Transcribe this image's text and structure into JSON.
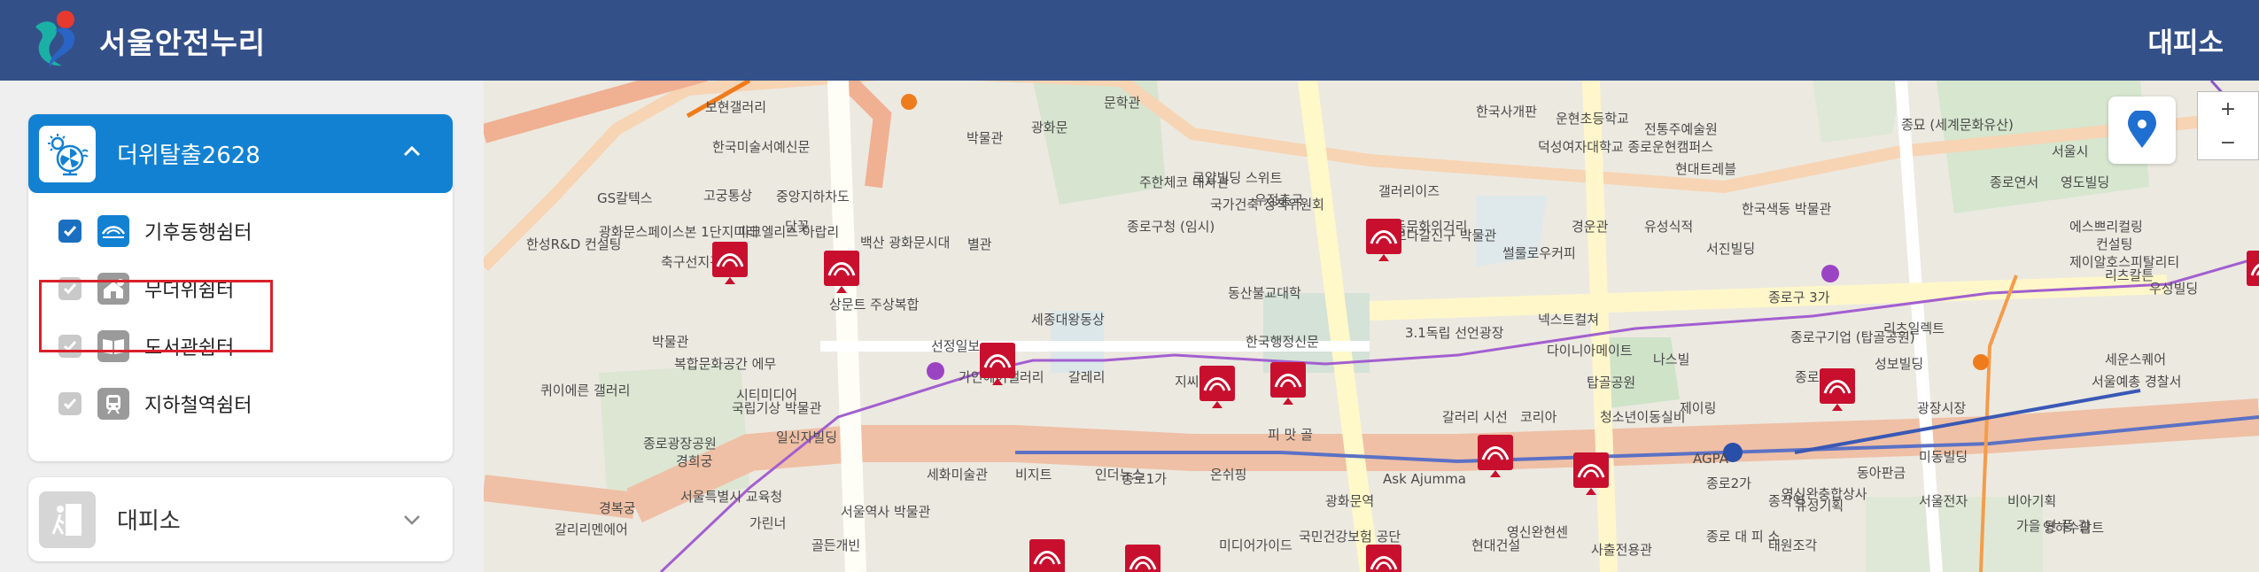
{
  "header": {
    "app_title": "서울안전누리",
    "right_label": "대피소",
    "logo_icon": "seoul-logo-icon"
  },
  "sidebar": {
    "panel1": {
      "title": "더위탈출2628",
      "icon": "cooling-fan-sun-icon",
      "expanded": true,
      "items": [
        {
          "label": "기후동행쉼터",
          "checked": true,
          "icon": "shelter-icon"
        },
        {
          "label": "무더위쉼터",
          "checked": true,
          "icon": "house-sun-icon"
        },
        {
          "label": "도서관쉼터",
          "checked": true,
          "icon": "book-icon"
        },
        {
          "label": "지하철역쉼터",
          "checked": true,
          "icon": "subway-icon"
        }
      ]
    },
    "panel2": {
      "title": "대피소",
      "icon": "evacuation-icon",
      "expanded": false
    }
  },
  "map": {
    "labels": [
      "보현갤러리",
      "한국미술서예신문",
      "박물관",
      "광화문",
      "경복궁",
      "고궁통상",
      "중앙지하차도",
      "GS칼텍스",
      "광화문스페이스본 1단지미래",
      "피크엘리스 아랍리",
      "담꽃",
      "한성R&D 컨설팅",
      "축구선지관",
      "백산 광화문시대",
      "별관",
      "종로구청 (임시)",
      "국가건축 정책위원회",
      "주한체코 대사관",
      "로얄빌딩 스위트",
      "우정총국",
      "갤러리이즈",
      "인사동문화의거리",
      "덕성여자대학교 종로운현캠퍼스",
      "운현초등학교",
      "현대트레블",
      "전통주예술원",
      "종묘 (세계문화유산)",
      "종로연서",
      "서울시",
      "영도빌딩",
      "에스쁘리컬링",
      "컨설팅",
      "제이알호스피탈리티",
      "리츠칼튼",
      "우성빌딩",
      "세종대왕동상",
      "동산불교대학",
      "보다갈신구 박물관",
      "썰룰로우커피",
      "서진빌딩",
      "한국색동 박물관",
      "경운관",
      "유성식적",
      "3.1독립 선언광장",
      "넥스트컬쳐",
      "다이니아메이트",
      "나스빌",
      "종로구기업 (탑골공원)",
      "성보빌딩",
      "종로3가",
      "종로구 3가",
      "리츠일렉트",
      "세운스퀘어",
      "서울예총 경찰서",
      "한국행정신문",
      "갈레리",
      "문학관",
      "박물관",
      "복합문화공간 에무",
      "퀴이에른 갤러리",
      "국립기상 박물관",
      "일신자빌딩",
      "시티미디어",
      "상문트 주상복합",
      "선정일보",
      "가인헤어갤러리",
      "지씨엔",
      "피 맛 골",
      "갈러리 시선",
      "코리아",
      "청소년이동실비",
      "탑골공원",
      "제이링",
      "미동빌딩",
      "광장시장",
      "종로광장공원",
      "경희궁",
      "서울특별시 교육청",
      "서울역사 박물관",
      "세화미술관",
      "비지트",
      "인더뉴스",
      "온쉬핑",
      "Ask Ajumma",
      "AGPA",
      "유성기획",
      "영신완충합상사",
      "동아판금",
      "서울전자",
      "비아기획",
      "가을 단 풍 길",
      "종로 대 피 소",
      "갈리리멘에어",
      "가린너",
      "골든개빈",
      "미디어가이드",
      "국민건강보험 공단",
      "영신완현센",
      "사출전용관",
      "태원조각",
      "영하수팜트",
      "종로1가",
      "종로2가",
      "종각역",
      "광화문역",
      "현대건설",
      "한국사개판"
    ]
  },
  "colors": {
    "header_bg": "#345089",
    "panel_accent": "#1281d2",
    "highlight_border": "#d9202a",
    "shelter_marker": "#c8102e",
    "subway_line5": "#9b44c3",
    "subway_line1": "#2a4fa8",
    "subway_line3": "#ef7c1c"
  },
  "controls": {
    "zoom_in": "+",
    "zoom_out": "−",
    "locate_icon": "location-pin-icon"
  }
}
